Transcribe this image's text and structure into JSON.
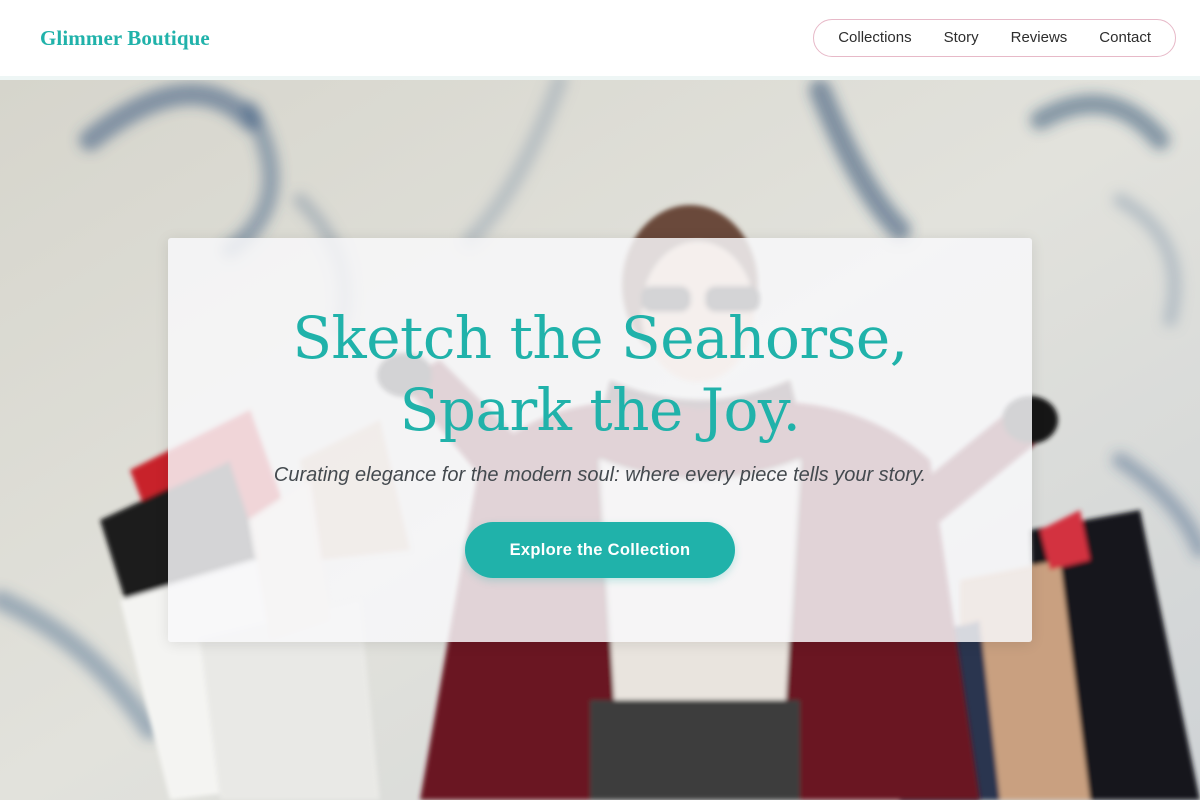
{
  "header": {
    "brand": "Glimmer Boutique",
    "nav": [
      {
        "label": "Collections"
      },
      {
        "label": "Story"
      },
      {
        "label": "Reviews"
      },
      {
        "label": "Contact"
      }
    ]
  },
  "hero": {
    "title_line_1": "Sketch the Seahorse,",
    "title_line_2": "Spark the Joy.",
    "tagline": "Curating elegance for the modern soul: where every piece tells your story.",
    "cta_label": "Explore the Collection"
  },
  "colors": {
    "accent": "#20b2aa",
    "nav_border": "#e7b9c8",
    "text_dark": "#2d2d2d"
  }
}
